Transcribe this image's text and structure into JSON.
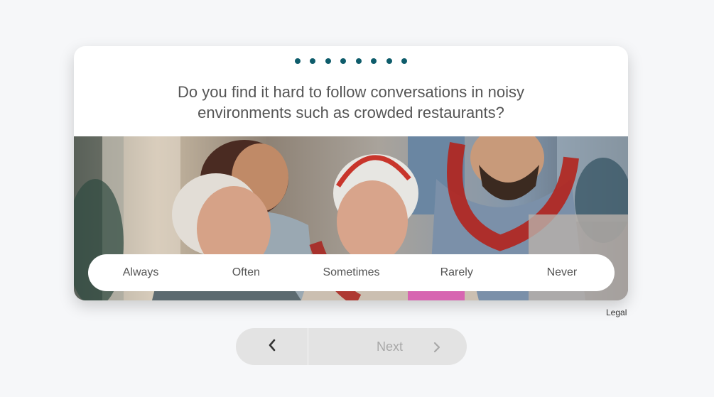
{
  "progress": {
    "steps": 8
  },
  "question": {
    "text": "Do you find it hard to follow conversations in noisy environments such as crowded restaurants?"
  },
  "answers": [
    {
      "label": "Always"
    },
    {
      "label": "Often"
    },
    {
      "label": "Sometimes"
    },
    {
      "label": "Rarely"
    },
    {
      "label": "Never"
    }
  ],
  "footer": {
    "legal_label": "Legal"
  },
  "nav": {
    "back_icon": "chevron-left-icon",
    "next_label": "Next",
    "next_icon": "chevron-right-icon"
  },
  "colors": {
    "accent": "#0e5c6b",
    "background": "#f6f7f9",
    "text": "#555555",
    "nav_bg": "#e3e3e3",
    "disabled_text": "#a8a8a8"
  }
}
